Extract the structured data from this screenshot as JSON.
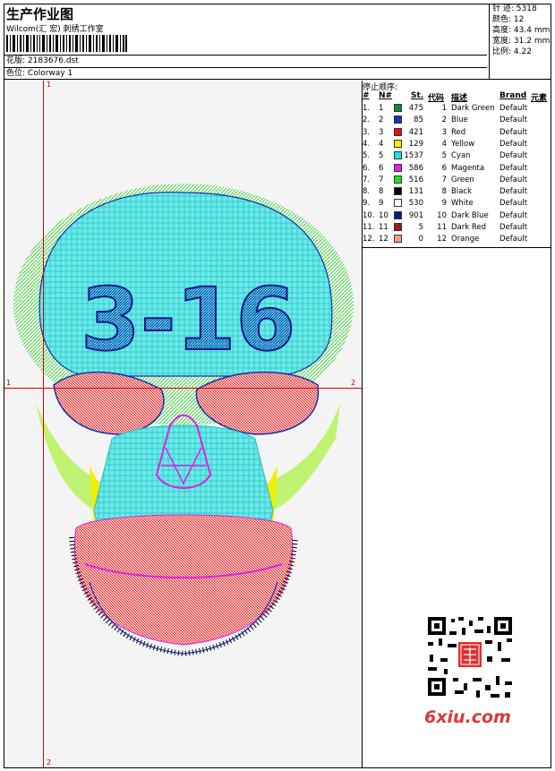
{
  "header": {
    "title": "生产作业图",
    "company": "Wilcom(汇 宏) 刺绣工作室",
    "design_label": "花版:",
    "design_value": "2183676.dst",
    "colorway_label": "色位:",
    "colorway_value": "Colorway 1"
  },
  "stats": [
    {
      "label": "针 迹:",
      "value": "5318"
    },
    {
      "label": "颜色:",
      "value": "12"
    },
    {
      "label": "高度:",
      "value": "43.4 mm"
    },
    {
      "label": "宽度:",
      "value": "31.2 mm"
    },
    {
      "label": "比例:",
      "value": "4.22"
    }
  ],
  "stop_sequence": {
    "title": "停止顺序:",
    "headers": {
      "num": "#",
      "n": "N#",
      "st": "St.",
      "code": "代码",
      "desc": "描述",
      "brand": "Brand",
      "elem": "元素"
    },
    "rows": [
      {
        "num": "1.",
        "n": "1",
        "st": "475",
        "code": "1",
        "desc": "Dark Green",
        "brand": "Default",
        "color": "#0a8f2a"
      },
      {
        "num": "2.",
        "n": "2",
        "st": "85",
        "code": "2",
        "desc": "Blue",
        "brand": "Default",
        "color": "#1535b8"
      },
      {
        "num": "3.",
        "n": "3",
        "st": "421",
        "code": "3",
        "desc": "Red",
        "brand": "Default",
        "color": "#e01010"
      },
      {
        "num": "4.",
        "n": "4",
        "st": "129",
        "code": "4",
        "desc": "Yellow",
        "brand": "Default",
        "color": "#f5ee00"
      },
      {
        "num": "5.",
        "n": "5",
        "st": "1537",
        "code": "5",
        "desc": "Cyan",
        "brand": "Default",
        "color": "#22e0e0"
      },
      {
        "num": "6.",
        "n": "6",
        "st": "586",
        "code": "6",
        "desc": "Magenta",
        "brand": "Default",
        "color": "#e020e0"
      },
      {
        "num": "7.",
        "n": "7",
        "st": "516",
        "code": "7",
        "desc": "Green",
        "brand": "Default",
        "color": "#20e020"
      },
      {
        "num": "8.",
        "n": "8",
        "st": "131",
        "code": "8",
        "desc": "Black",
        "brand": "Default",
        "color": "#000000"
      },
      {
        "num": "9.",
        "n": "9",
        "st": "530",
        "code": "9",
        "desc": "White",
        "brand": "Default",
        "color": "#ffffff"
      },
      {
        "num": "10.",
        "n": "10",
        "st": "901",
        "code": "10",
        "desc": "Dark Blue",
        "brand": "Default",
        "color": "#0a1a8a"
      },
      {
        "num": "11.",
        "n": "11",
        "st": "5",
        "code": "11",
        "desc": "Dark Red",
        "brand": "Default",
        "color": "#a01818"
      },
      {
        "num": "12.",
        "n": "12",
        "st": "0",
        "code": "12",
        "desc": "Orange",
        "brand": "Default",
        "color": "#f0a080"
      }
    ]
  },
  "design": {
    "text": "3-16",
    "axis_labels": {
      "top": "1",
      "bottom": "2",
      "left": "1",
      "right": "2"
    }
  },
  "watermark": {
    "brand": "6xiu.com"
  }
}
